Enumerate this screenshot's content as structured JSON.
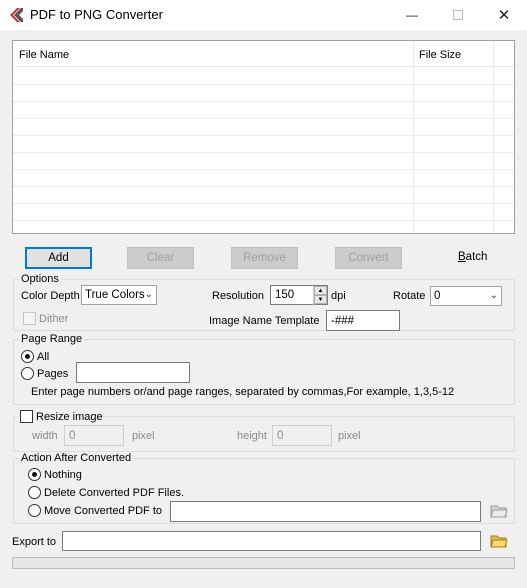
{
  "window": {
    "title": "PDF to PNG Converter",
    "minimize_icon": "minimize-icon",
    "maximize_icon": "maximize-icon",
    "close_icon": "close-icon"
  },
  "file_list": {
    "columns": [
      "File Name",
      "File Size"
    ],
    "rows": []
  },
  "actions": {
    "add": "Add",
    "clear": "Clear",
    "remove": "Remove",
    "convert": "Convert",
    "batch": "Batch"
  },
  "options": {
    "legend": "Options",
    "color_depth_label": "Color Depth",
    "color_depth_value": "True Colors",
    "resolution_label": "Resolution",
    "resolution_value": "150",
    "resolution_unit": "dpi",
    "rotate_label": "Rotate",
    "rotate_value": "0",
    "dither_label": "Dither",
    "dither_checked": false,
    "image_name_template_label": "Image Name Template",
    "image_name_template_value": "-###"
  },
  "page_range": {
    "legend": "Page Range",
    "all_label": "All",
    "pages_label": "Pages",
    "selected": "All",
    "pages_value": "",
    "hint": "Enter page numbers or/and page ranges, separated by commas,For example, 1,3,5-12"
  },
  "resize": {
    "label": "Resize image",
    "checked": false,
    "width_label": "width",
    "width_value": "0",
    "height_label": "height",
    "height_value": "0",
    "unit": "pixel"
  },
  "after_convert": {
    "legend": "Action After Converted",
    "nothing_label": "Nothing",
    "delete_label": "Delete Converted PDF Files.",
    "move_label": "Move Converted PDF to",
    "selected": "Nothing",
    "move_path": ""
  },
  "export": {
    "label": "Export to",
    "path": ""
  },
  "progress": 0
}
